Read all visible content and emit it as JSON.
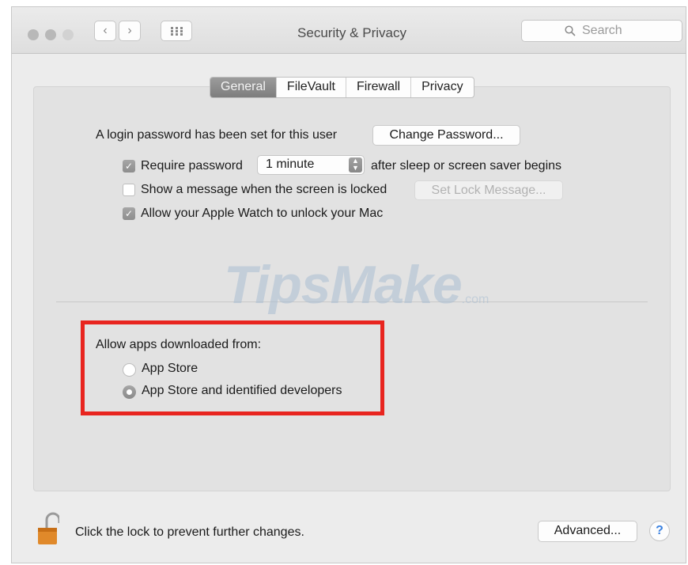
{
  "window": {
    "title": "Security & Privacy",
    "search_placeholder": "Search",
    "back_glyph": "‹",
    "forward_glyph": "›"
  },
  "tabs": [
    {
      "label": "General",
      "selected": true
    },
    {
      "label": "FileVault",
      "selected": false
    },
    {
      "label": "Firewall",
      "selected": false
    },
    {
      "label": "Privacy",
      "selected": false
    }
  ],
  "general": {
    "login_text": "A login password has been set for this user",
    "change_password_label": "Change Password...",
    "require_password_label": "Require password",
    "require_password_checked": true,
    "require_delay_value": "1 minute",
    "after_sleep_text": "after sleep or screen saver begins",
    "show_message_label": "Show a message when the screen is locked",
    "show_message_checked": false,
    "set_lock_message_label": "Set Lock Message...",
    "apple_watch_label": "Allow your Apple Watch to unlock your Mac",
    "apple_watch_checked": true
  },
  "watermark": {
    "brand": "TipsMake",
    "domain": ".com"
  },
  "allow_apps": {
    "heading": "Allow apps downloaded from:",
    "options": [
      {
        "label": "App Store",
        "selected": false
      },
      {
        "label": "App Store and identified developers",
        "selected": true
      }
    ]
  },
  "footer": {
    "lock_text": "Click the lock to prevent further changes.",
    "advanced_label": "Advanced...",
    "help_glyph": "?"
  },
  "colors": {
    "highlight_box": "#e8251f",
    "help_icon": "#3b82e0",
    "lock_icon": "#e0892a"
  }
}
